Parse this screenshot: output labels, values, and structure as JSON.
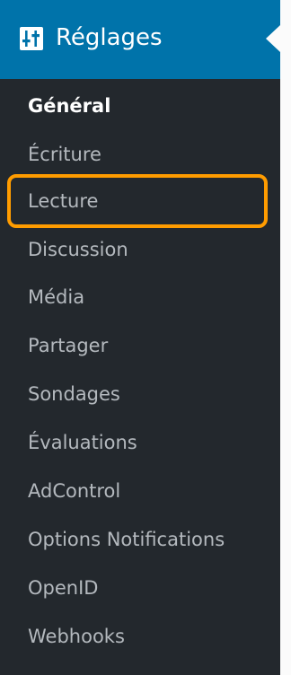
{
  "header": {
    "title": "Réglages",
    "icon": "settings-sliders-icon",
    "accent_color": "#0073aa"
  },
  "menu": {
    "items": [
      {
        "label": "Général",
        "active": true
      },
      {
        "label": "Écriture"
      },
      {
        "label": "Lecture",
        "highlighted": true
      },
      {
        "label": "Discussion"
      },
      {
        "label": "Média"
      },
      {
        "label": "Partager"
      },
      {
        "label": "Sondages"
      },
      {
        "label": "Évaluations"
      },
      {
        "label": "AdControl"
      },
      {
        "label": "Options Notifications"
      },
      {
        "label": "OpenID"
      },
      {
        "label": "Webhooks"
      }
    ]
  },
  "colors": {
    "menu_bg": "#23282d",
    "item_text": "#b4b9be",
    "active_text": "#ffffff",
    "highlight_border": "#ff9c00"
  }
}
